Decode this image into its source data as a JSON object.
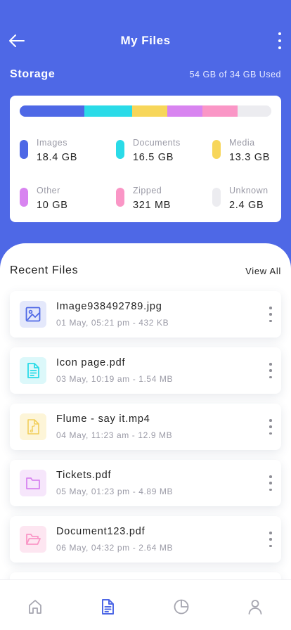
{
  "header": {
    "title": "My Files",
    "back_icon": "arrow-left-icon",
    "more_icon": "more-vertical-icon"
  },
  "storage": {
    "label": "Storage",
    "used_text": "54 GB of 34 GB Used",
    "segments": [
      {
        "name": "Images",
        "value": "18.4 GB",
        "color": "#4e68e6",
        "share": 0.257
      },
      {
        "name": "Documents",
        "value": "16.5 GB",
        "color": "#2adbe8",
        "share": 0.189
      },
      {
        "name": "Media",
        "value": "13.3 GB",
        "color": "#f7d65a",
        "share": 0.14
      },
      {
        "name": "Other",
        "value": "10 GB",
        "color": "#d884f0",
        "share": 0.14
      },
      {
        "name": "Zipped",
        "value": "321 MB",
        "color": "#fa96c6",
        "share": 0.14
      },
      {
        "name": "Unknown",
        "value": "2.4 GB",
        "color": "#ececf0",
        "share": 0.134
      }
    ]
  },
  "recent": {
    "title": "Recent Files",
    "view_all": "View All",
    "files": [
      {
        "name": "Image938492789.jpg",
        "meta": "01 May, 05:21 pm - 432 KB",
        "icon": "image-icon",
        "bg": "#e4e8fb",
        "fg": "#4e68e6"
      },
      {
        "name": "Icon page.pdf",
        "meta": "03 May, 10:19 am - 1.54 MB",
        "icon": "document-icon",
        "bg": "#dcf8fa",
        "fg": "#2adbe8"
      },
      {
        "name": "Flume - say it.mp4",
        "meta": "04 May, 11:23 am - 12.9 MB",
        "icon": "music-file-icon",
        "bg": "#fdf5d8",
        "fg": "#f2cf5a"
      },
      {
        "name": "Tickets.pdf",
        "meta": "05 May, 01:23 pm - 4.89 MB",
        "icon": "folder-icon",
        "bg": "#f6e6fb",
        "fg": "#d884f0"
      },
      {
        "name": "Document123.pdf",
        "meta": "06 May, 04:32 pm - 2.64 MB",
        "icon": "folder-open-icon",
        "bg": "#fde6f1",
        "fg": "#fa96c6"
      }
    ]
  },
  "nav": {
    "items": [
      {
        "name": "home-icon",
        "active": false
      },
      {
        "name": "files-icon",
        "active": true
      },
      {
        "name": "pie-chart-icon",
        "active": false
      },
      {
        "name": "user-icon",
        "active": false
      }
    ],
    "active_color": "#4e68e6",
    "inactive_color": "#a6a6b0"
  }
}
